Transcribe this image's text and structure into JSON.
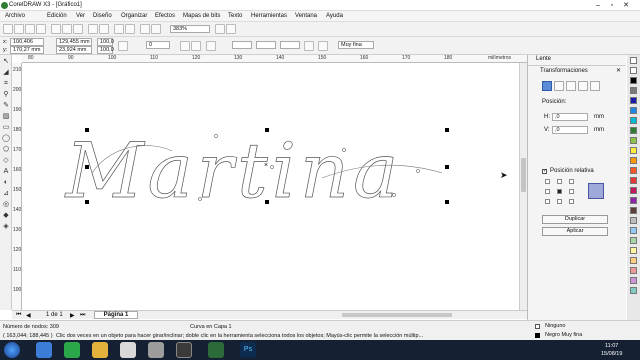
{
  "app": {
    "title": "CorelDRAW X3 - [Gráfico1]"
  },
  "window_controls": {
    "min": "–",
    "max": "▫",
    "close": "✕"
  },
  "menu": {
    "items": [
      "Archivo",
      "Edición",
      "Ver",
      "Diseño",
      "Organizar",
      "Efectos",
      "Mapas de bits",
      "Texto",
      "Herramientas",
      "Ventana",
      "Ayuda"
    ]
  },
  "toolbar": {
    "zoom": "383%"
  },
  "propbar": {
    "x": "100,406 mm",
    "y": "170,27 mm",
    "w": "129,455 mm",
    "h": "23,924 mm",
    "scale_x": "100,0",
    "scale_y": "100,0",
    "angle": "0",
    "outline_width": "Muy fina"
  },
  "ruler": {
    "h_ticks": [
      "80",
      "90",
      "100",
      "110",
      "120",
      "130",
      "140",
      "150",
      "160",
      "170",
      "180"
    ],
    "unit": "milímetros",
    "v_ticks": [
      "210",
      "200",
      "190",
      "180",
      "170",
      "160",
      "150",
      "140",
      "130",
      "120",
      "110",
      "100"
    ]
  },
  "canvas": {
    "text": "Martina"
  },
  "pages": {
    "current": "1 de 1",
    "tab": "Página 1"
  },
  "docker": {
    "lente": "Lente",
    "title": "Transformaciones",
    "section": "Posición:",
    "h_label": "H:",
    "h_value": ",0",
    "v_label": "V:",
    "v_value": ",0",
    "unit": "mm",
    "relative": "Posición relativa",
    "duplicate": "Duplicar",
    "apply": "Aplicar"
  },
  "palette": {
    "colors": [
      "#ffffff",
      "#000000",
      "#7a7a7a",
      "#1a1aa8",
      "#1e88e5",
      "#00bcd4",
      "#2e7d32",
      "#8bc34a",
      "#ffeb3b",
      "#ff9800",
      "#ff5722",
      "#e53935",
      "#c2185b",
      "#8e24aa",
      "#5d4037",
      "#bdbdbd",
      "#90caf9",
      "#a5d6a7",
      "#fff59d",
      "#ffcc80",
      "#ef9a9a",
      "#ce93d8",
      "#80cbc4"
    ]
  },
  "status": {
    "nodes": "Número de nodos: 309",
    "layer": "Curva en Capa 1",
    "coords": "( 163,044; 188,445 )",
    "hint": "Clic dos veces en un objeto para hacer girar/inclinar; doble clic en la herramienta selecciona todos los objetos; Mayús-clic permite la selección múltip...",
    "fill": "Ninguno",
    "outline": "Negro  Muy fina"
  },
  "taskbar": {
    "time": "11:07",
    "date": "15/08/19"
  }
}
